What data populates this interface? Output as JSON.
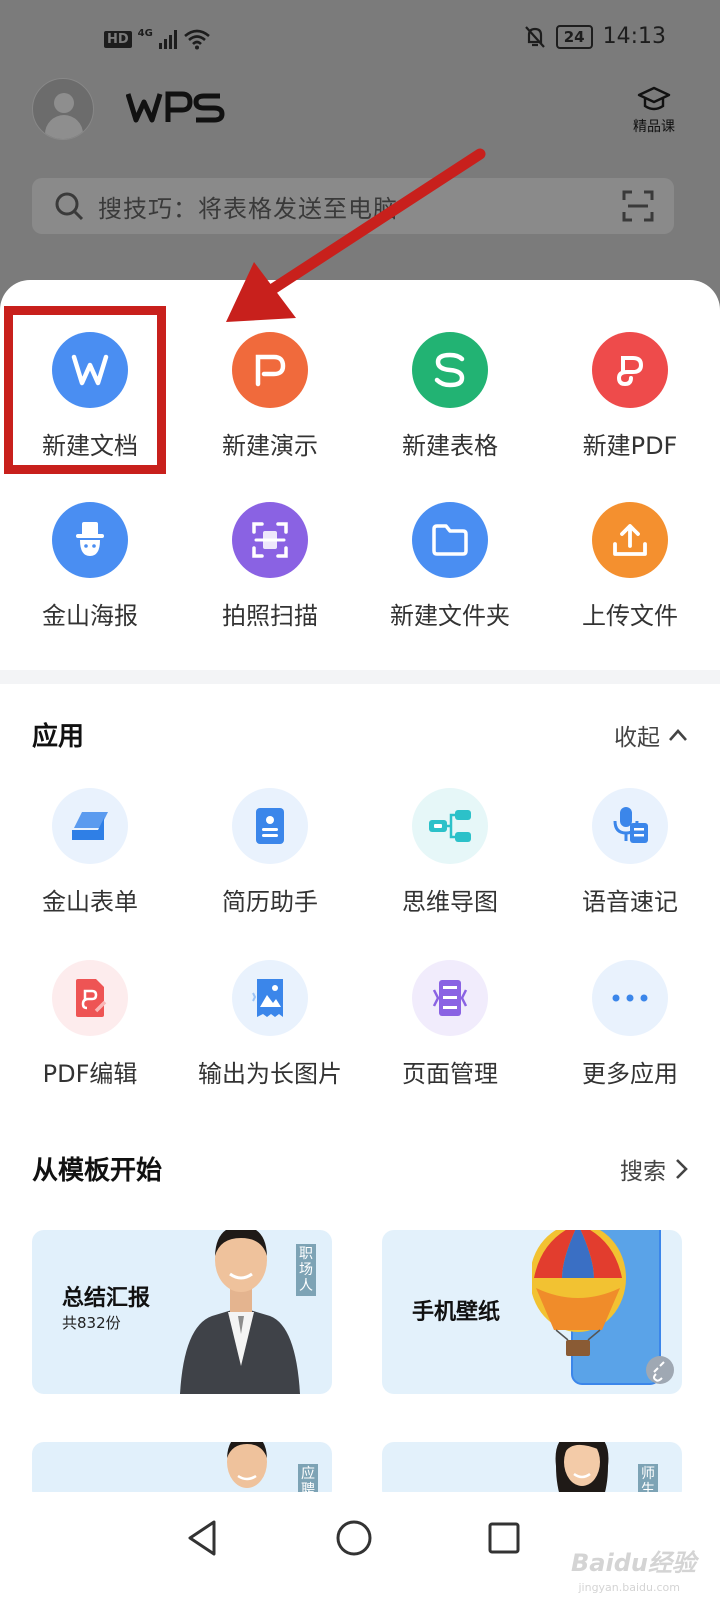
{
  "status_bar": {
    "hd": "HD",
    "network": "4G",
    "battery": "24",
    "time": "14:13"
  },
  "header": {
    "logo_text": "WPS",
    "course_label": "精品课"
  },
  "search": {
    "placeholder": "搜技巧：将表格发送至电脑"
  },
  "quick_create": [
    {
      "label": "新建文档",
      "icon": "word-icon",
      "color": "#4a8ef2"
    },
    {
      "label": "新建演示",
      "icon": "ppt-icon",
      "color": "#f06a3c"
    },
    {
      "label": "新建表格",
      "icon": "sheet-icon",
      "color": "#22b373"
    },
    {
      "label": "新建PDF",
      "icon": "pdf-icon",
      "color": "#ee4b4b"
    },
    {
      "label": "金山海报",
      "icon": "poster-icon",
      "color": "#4a8ef2"
    },
    {
      "label": "拍照扫描",
      "icon": "scan-icon",
      "color": "#8a62e3"
    },
    {
      "label": "新建文件夹",
      "icon": "folder-icon",
      "color": "#4a8ef2"
    },
    {
      "label": "上传文件",
      "icon": "upload-icon",
      "color": "#f4902f"
    }
  ],
  "apps": {
    "title": "应用",
    "collapse_label": "收起",
    "items": [
      {
        "label": "金山表单",
        "icon": "form-icon"
      },
      {
        "label": "简历助手",
        "icon": "resume-icon"
      },
      {
        "label": "思维导图",
        "icon": "mindmap-icon"
      },
      {
        "label": "语音速记",
        "icon": "voice-note-icon"
      },
      {
        "label": "PDF编辑",
        "icon": "pdf-edit-icon"
      },
      {
        "label": "输出为长图片",
        "icon": "long-image-icon"
      },
      {
        "label": "页面管理",
        "icon": "page-manage-icon"
      },
      {
        "label": "更多应用",
        "icon": "more-icon"
      }
    ]
  },
  "templates": {
    "title": "从模板开始",
    "search_label": "搜索",
    "items": [
      {
        "title": "总结汇报",
        "count": "共832份",
        "tag": "职场人"
      },
      {
        "title": "手机壁纸",
        "count": "",
        "tag": ""
      },
      {
        "title": "",
        "count": "",
        "tag": "应聘"
      },
      {
        "title": "",
        "count": "",
        "tag": "师生"
      }
    ]
  },
  "watermark": {
    "text": "Baidu经验",
    "sub": "jingyan.baidu.com"
  }
}
